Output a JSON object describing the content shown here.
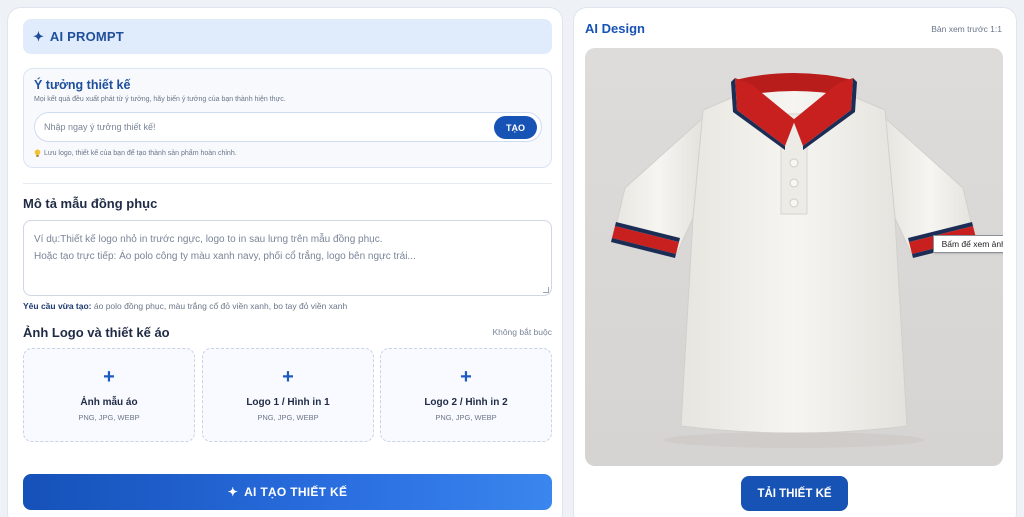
{
  "prompt_header": {
    "label": "AI PROMPT"
  },
  "idea": {
    "title": "Ý tưởng thiết kế",
    "subtitle": "Mọi kết quả đều xuất phát từ ý tưởng, hãy biến ý tưởng của bạn thành hiện thực.",
    "placeholder": "Nhập ngay ý tưởng thiết kế!",
    "value": "",
    "button_label": "TẠO",
    "note": "Lưu logo, thiết kế của bạn để tạo thành sản phẩm hoàn chỉnh."
  },
  "description": {
    "title": "Mô tả mẫu đồng phục",
    "placeholder_line1": "Ví dụ:Thiết kế logo nhỏ in trước ngực, logo to in sau lưng trên mẫu đồng phục.",
    "placeholder_line2": "Hoặc tạo trực tiếp: Áo polo công ty màu xanh navy, phối cổ trắng, logo bên ngực trái...",
    "requirement_label": "Yêu cầu vừa tạo:",
    "requirement_text": "áo polo đồng phục, màu trắng cổ đỏ viền xanh, bo tay đỏ viền xanh"
  },
  "uploads": {
    "title": "Ảnh Logo và thiết kế áo",
    "optional": "Không bắt buộc",
    "items": [
      {
        "label": "Ảnh mẫu áo",
        "formats": "PNG, JPG, WEBP"
      },
      {
        "label": "Logo 1 / Hình in 1",
        "formats": "PNG, JPG, WEBP"
      },
      {
        "label": "Logo 2 / Hình in 2",
        "formats": "PNG, JPG, WEBP"
      }
    ]
  },
  "create_button": {
    "label": "AI TẠO THIẾT KẾ"
  },
  "design_panel": {
    "title": "AI Design",
    "preview_label": "Bản xem trước 1:1",
    "tooltip": "Bấm để xem ảnh lớn",
    "download_label": "TẢI THIẾT KẾ"
  },
  "colors": {
    "accent": "#1753b5",
    "shirt_body": "#f4f3ee",
    "collar_red": "#c8201f",
    "trim_navy": "#1c2d55"
  },
  "icons": {
    "sparkle": "✦",
    "plus": "+",
    "bulb": "bulb-icon"
  }
}
